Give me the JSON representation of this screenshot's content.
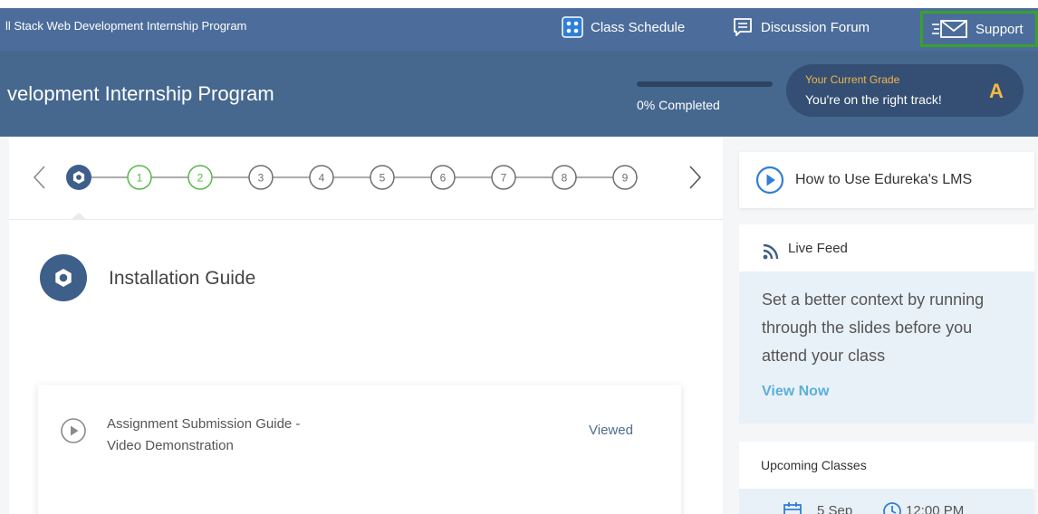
{
  "topbar": {
    "program_name": "ll Stack Web Development Internship Program",
    "nav": {
      "class_schedule": "Class Schedule",
      "discussion_forum": "Discussion Forum",
      "support": "Support"
    }
  },
  "header": {
    "title": "velopment Internship Program",
    "progress_label": "0% Completed",
    "progress_percent": 0,
    "grade_label": "Your Current Grade",
    "grade_message": "You're on the right track!",
    "grade_letter": "A"
  },
  "stepper": {
    "steps": [
      "1",
      "2",
      "3",
      "4",
      "5",
      "6",
      "7",
      "8",
      "9"
    ],
    "completed_steps": [
      "1",
      "2"
    ],
    "colors": {
      "active": "#3e5f8a",
      "completed": "#56b745",
      "pending": "#6f6f6f",
      "line": "#7a7a7a"
    }
  },
  "module": {
    "title": "Installation Guide",
    "items": [
      {
        "title": "Assignment Submission Guide -\nVideo Demonstration",
        "status": "Viewed"
      }
    ]
  },
  "sidebar": {
    "lms_link": "How to Use Edureka's LMS",
    "live_feed": {
      "title": "Live Feed",
      "body": "Set a better context by running through the slides before you attend your class",
      "link": "View Now"
    },
    "upcoming": {
      "title": "Upcoming Classes",
      "date": "5 Sep",
      "time": "12:00 PM"
    }
  }
}
